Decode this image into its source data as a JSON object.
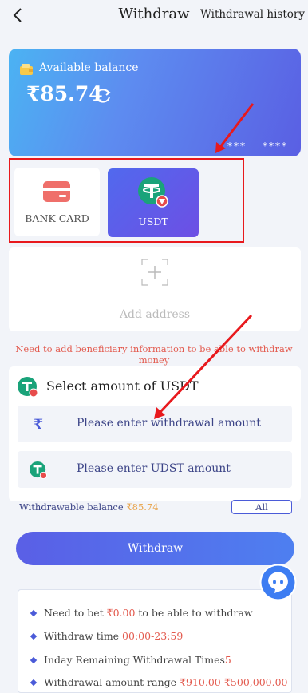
{
  "header": {
    "title": "Withdraw",
    "history_label": "Withdrawal history"
  },
  "balance_card": {
    "label": "Available balance",
    "amount": "₹85.74",
    "masked_left": "***",
    "masked_right": "****"
  },
  "methods": [
    {
      "label": "BANK CARD",
      "selected": false
    },
    {
      "label": "USDT",
      "selected": true
    }
  ],
  "address": {
    "label": "Add address"
  },
  "warning": "Need to add beneficiary information to be able to withdraw money",
  "amount_panel": {
    "title": "Select amount of USDT",
    "rupee_symbol": "₹",
    "inr_placeholder": "Please enter withdrawal amount",
    "usdt_placeholder": "Please enter UDST amount"
  },
  "withdrawable": {
    "label": "Withdrawable balance ",
    "value": "₹85.74",
    "all_label": "All"
  },
  "withdraw_button": "Withdraw",
  "rules": [
    {
      "pre": "Need to bet ",
      "red": "₹0.00",
      "post": " to be able to withdraw"
    },
    {
      "pre": "Withdraw time ",
      "red": "00:00-23:59",
      "post": ""
    },
    {
      "pre": "Inday Remaining Withdrawal Times",
      "red": "5",
      "post": ""
    },
    {
      "pre": "Withdrawal amount range ",
      "red": "₹910.00-₹500,000.00",
      "post": ""
    }
  ],
  "colors": {
    "accent": "#4e6ae8",
    "warning": "#e35a4e",
    "annotation_red": "#e8191d",
    "tether_green": "#1aa37a"
  }
}
